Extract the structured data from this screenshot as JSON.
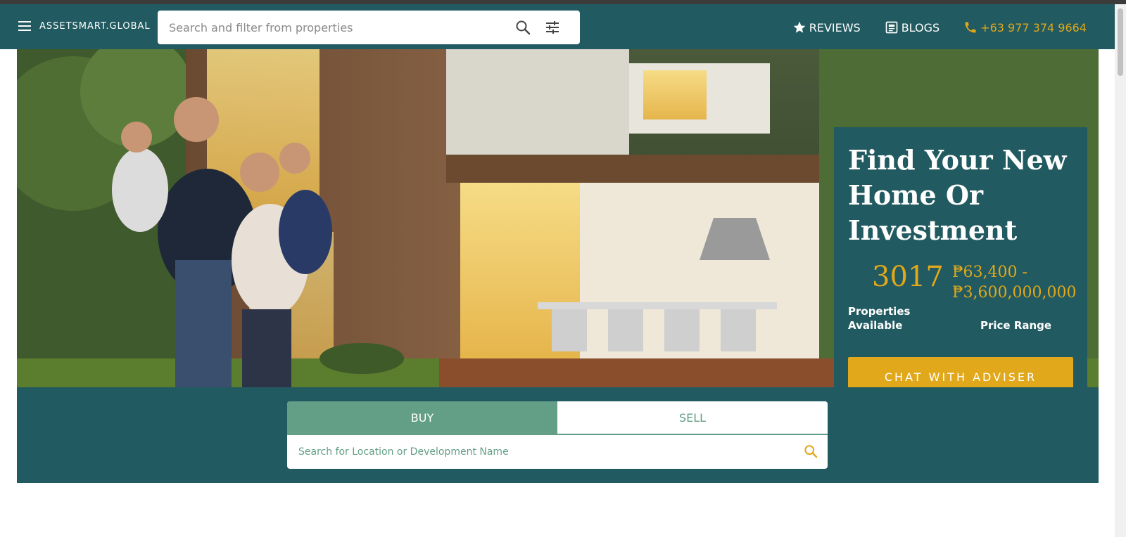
{
  "header": {
    "logo_text": "ASSETSMART.GLOBAL",
    "search_placeholder": "Search and filter from properties",
    "links": {
      "reviews": "REVIEWS",
      "blogs": "BLOGS",
      "phone": "+63 977 374 9664"
    }
  },
  "hero": {
    "title": "Find Your New Home Or Investment",
    "stats": {
      "properties_count": "3017",
      "properties_label": "Properties Available",
      "price_range": "₱63,400 - ₱3,600,000,000",
      "price_label": "Price Range"
    },
    "cta_label": "CHAT WITH ADVISER"
  },
  "search_panel": {
    "tabs": [
      "BUY",
      "SELL"
    ],
    "active_tab": "BUY",
    "location_placeholder": "Search for Location or Development Name"
  },
  "colors": {
    "brand_teal": "#215a60",
    "accent_gold": "#e0a81a",
    "tab_green": "#639e86"
  },
  "icons": {
    "menu": "hamburger-icon",
    "search": "search-icon",
    "filter": "tune-icon",
    "reviews": "star-icon",
    "blogs": "article-icon",
    "phone": "phone-icon"
  }
}
